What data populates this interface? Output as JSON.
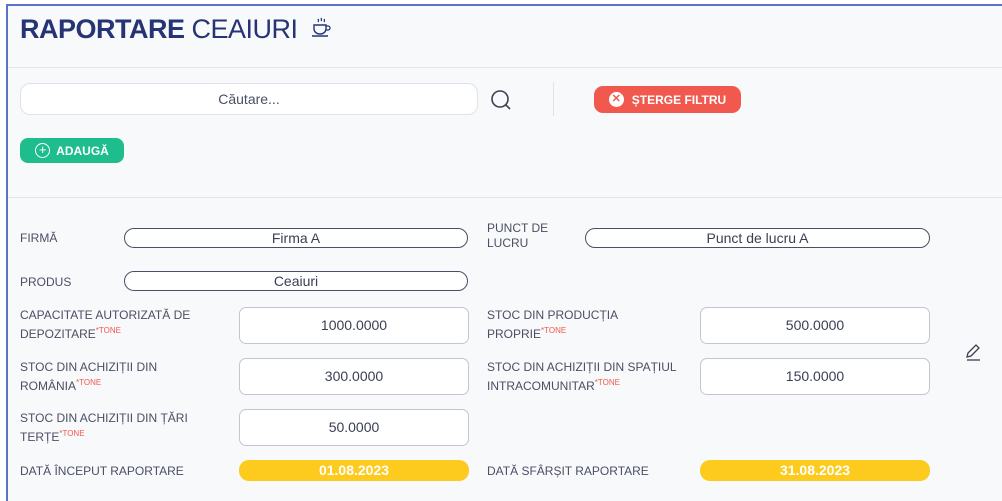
{
  "header": {
    "title_bold": "RAPORTARE",
    "title_light": "CEAIURI"
  },
  "filters": {
    "search_placeholder": "Căutare...",
    "clear_filter_label": "ȘTERGE FILTRU",
    "add_label": "ADAUGĂ"
  },
  "record": {
    "firma_label": "FIRMĂ",
    "firma_value": "Firma A",
    "punct_label_line1": "PUNCT DE",
    "punct_label_line2": "LUCRU",
    "punct_value": "Punct de lucru A",
    "produs_label": "PRODUS",
    "produs_value": "Ceaiuri",
    "unit": "*TONE",
    "capacitate_label_line1": "CAPACITATE AUTORIZATĂ DE",
    "capacitate_label_line2": "DEPOZITARE",
    "capacitate_value": "1000.0000",
    "stoc_productie_label_line1": "STOC DIN PRODUCȚIA",
    "stoc_productie_label_line2": "PROPRIE",
    "stoc_productie_value": "500.0000",
    "stoc_romania_label_line1": "STOC DIN ACHIZIȚII DIN",
    "stoc_romania_label_line2": "ROMÂNIA",
    "stoc_romania_value": "300.0000",
    "stoc_intra_label_line1": "STOC DIN ACHIZIȚII DIN SPAȚIUL",
    "stoc_intra_label_line2": "INTRACOMUNITAR",
    "stoc_intra_value": "150.0000",
    "stoc_terte_label_line1": "STOC DIN ACHIZIȚII DIN ȚĂRI",
    "stoc_terte_label_line2": "TERȚE",
    "stoc_terte_value": "50.0000",
    "data_inceput_label": "DATĂ ÎNCEPUT RAPORTARE",
    "data_inceput_value": "01.08.2023",
    "data_sfarsit_label": "DATĂ SFÂRȘIT RAPORTARE",
    "data_sfarsit_value": "31.08.2023"
  },
  "icons": {
    "title": "teacup-icon",
    "search": "search-icon",
    "clear": "x-circle-icon",
    "add": "plus-circle-icon",
    "edit": "pencil-icon"
  },
  "colors": {
    "title": "#263375",
    "danger": "#f1594f",
    "success": "#1ebd8d",
    "date": "#fccb1e",
    "accent_border": "#5a72c8"
  }
}
